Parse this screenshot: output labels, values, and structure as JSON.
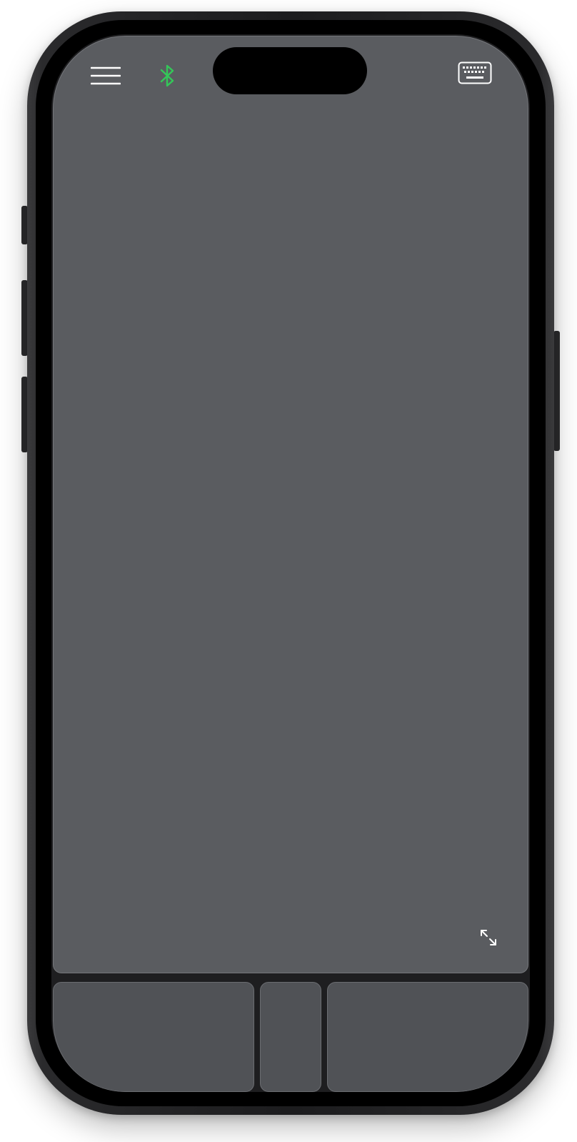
{
  "device": {
    "frame_color": "#1c1c1e",
    "screen_color": "#5a5c60"
  },
  "toolbar": {
    "menu_icon": "hamburger-menu-icon",
    "bluetooth_icon": "bluetooth-icon",
    "bluetooth_color": "#34c759",
    "keyboard_icon": "keyboard-icon"
  },
  "trackpad": {
    "expand_icon": "expand-arrows-icon"
  },
  "click_buttons": {
    "left": "",
    "middle": "",
    "right": ""
  }
}
